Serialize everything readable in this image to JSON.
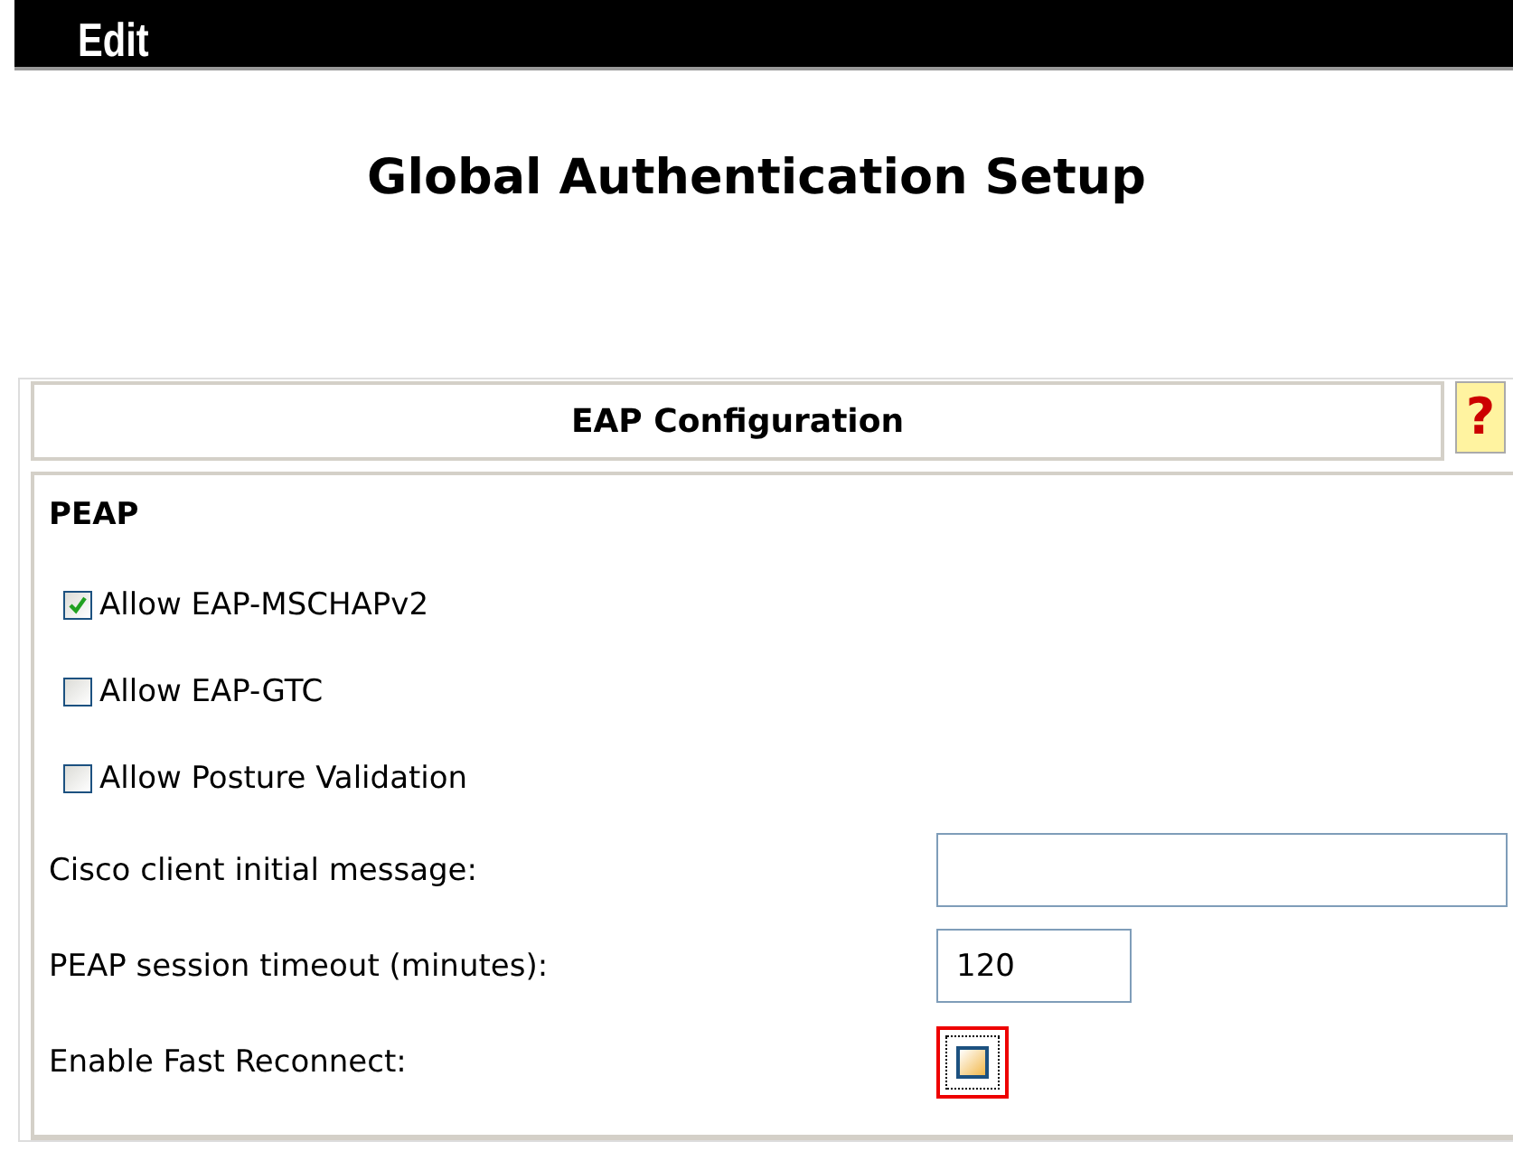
{
  "menu_bar": {
    "label": "Edit"
  },
  "page_title": "Global Authentication Setup",
  "panel": {
    "header": "EAP Configuration",
    "help_button": {
      "label": "?"
    },
    "section": "PEAP",
    "options": [
      {
        "label": "Allow EAP-MSCHAPv2",
        "checked": true
      },
      {
        "label": "Allow EAP-GTC",
        "checked": false
      },
      {
        "label": "Allow Posture Validation",
        "checked": false
      }
    ],
    "fields": [
      {
        "kind": "long_text",
        "label": "Cisco client initial message:"
      },
      {
        "kind": "short_text",
        "label": "PEAP session timeout (minutes):",
        "value": "120"
      },
      {
        "kind": "checkbox",
        "label": "Enable Fast Reconnect:",
        "checked": false,
        "highlighted": true
      }
    ]
  }
}
